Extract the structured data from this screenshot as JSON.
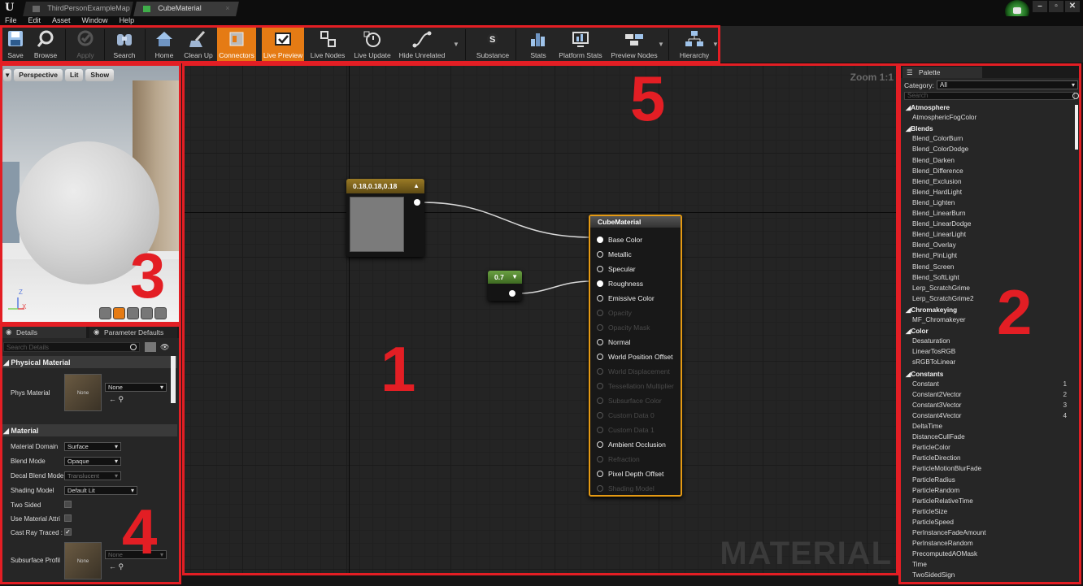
{
  "titlebar": {
    "logo": "U",
    "tabs": [
      {
        "label": "ThirdPersonExampleMap"
      },
      {
        "label": "CubeMaterial"
      }
    ]
  },
  "menubar": [
    "File",
    "Edit",
    "Asset",
    "Window",
    "Help"
  ],
  "toolbar": {
    "items": [
      {
        "label": "Save",
        "icon": "save-icon"
      },
      {
        "label": "Browse",
        "icon": "browse-icon"
      },
      {
        "label": "Apply",
        "icon": "apply-icon",
        "disabled": true
      },
      {
        "label": "Search",
        "icon": "search-icon"
      },
      {
        "label": "Home",
        "icon": "home-icon"
      },
      {
        "label": "Clean Up",
        "icon": "cleanup-icon"
      },
      {
        "label": "Connectors",
        "icon": "connectors-icon",
        "active": true
      },
      {
        "label": "Live Preview",
        "icon": "live-preview-icon",
        "active": true
      },
      {
        "label": "Live Nodes",
        "icon": "live-nodes-icon"
      },
      {
        "label": "Live Update",
        "icon": "live-update-icon"
      },
      {
        "label": "Hide Unrelated",
        "icon": "hide-unrelated-icon"
      },
      {
        "label": "Substance",
        "icon": "substance-icon"
      },
      {
        "label": "Stats",
        "icon": "stats-icon"
      },
      {
        "label": "Platform Stats",
        "icon": "platform-stats-icon"
      },
      {
        "label": "Preview Nodes",
        "icon": "preview-nodes-icon"
      },
      {
        "label": "Hierarchy",
        "icon": "hierarchy-icon"
      }
    ]
  },
  "viewport": {
    "perspective": "Perspective",
    "lit": "Lit",
    "show": "Show",
    "axis_z": "Z",
    "axis_x": "X"
  },
  "details": {
    "tab1": "Details",
    "tab2": "Parameter Defaults",
    "search_placeholder": "Search Details",
    "physical_material_header": "Physical Material",
    "phys_material_label": "Phys Material",
    "phys_material_value": "None",
    "thumb_none": "None",
    "material_header": "Material",
    "rows": [
      {
        "label": "Material Domain",
        "value": "Surface"
      },
      {
        "label": "Blend Mode",
        "value": "Opaque"
      },
      {
        "label": "Decal Blend Mode",
        "value": "Translucent"
      },
      {
        "label": "Shading Model",
        "value": "Default Lit"
      },
      {
        "label": "Two Sided"
      },
      {
        "label": "Use Material Attri"
      },
      {
        "label": "Cast Ray Traced :"
      },
      {
        "label": "Subsurface Profil",
        "value": "None"
      }
    ]
  },
  "graph": {
    "zoom": "Zoom 1:1",
    "watermark": "MATERIAL",
    "color_node": "0.18,0.18,0.18",
    "scalar_node": "0.7",
    "main_node": {
      "title": "CubeMaterial",
      "pins": [
        {
          "label": "Base Color",
          "state": "connected"
        },
        {
          "label": "Metallic",
          "state": "open"
        },
        {
          "label": "Specular",
          "state": "open"
        },
        {
          "label": "Roughness",
          "state": "connected"
        },
        {
          "label": "Emissive Color",
          "state": "open"
        },
        {
          "label": "Opacity",
          "state": "disabled"
        },
        {
          "label": "Opacity Mask",
          "state": "disabled"
        },
        {
          "label": "Normal",
          "state": "open"
        },
        {
          "label": "World Position Offset",
          "state": "open"
        },
        {
          "label": "World Displacement",
          "state": "disabled"
        },
        {
          "label": "Tessellation Multiplier",
          "state": "disabled"
        },
        {
          "label": "Subsurface Color",
          "state": "disabled"
        },
        {
          "label": "Custom Data 0",
          "state": "disabled"
        },
        {
          "label": "Custom Data 1",
          "state": "disabled"
        },
        {
          "label": "Ambient Occlusion",
          "state": "open"
        },
        {
          "label": "Refraction",
          "state": "disabled"
        },
        {
          "label": "Pixel Depth Offset",
          "state": "open"
        },
        {
          "label": "Shading Model",
          "state": "disabled"
        }
      ]
    }
  },
  "palette": {
    "tab": "Palette",
    "category_label": "Category:",
    "category_value": "All",
    "search_placeholder": "Search",
    "items": [
      {
        "text": "Atmosphere",
        "header": true
      },
      {
        "text": "AtmosphericFogColor"
      },
      {
        "text": "Blends",
        "header": true
      },
      {
        "text": "Blend_ColorBurn"
      },
      {
        "text": "Blend_ColorDodge"
      },
      {
        "text": "Blend_Darken"
      },
      {
        "text": "Blend_Difference"
      },
      {
        "text": "Blend_Exclusion"
      },
      {
        "text": "Blend_HardLight"
      },
      {
        "text": "Blend_Lighten"
      },
      {
        "text": "Blend_LinearBurn"
      },
      {
        "text": "Blend_LinearDodge"
      },
      {
        "text": "Blend_LinearLight"
      },
      {
        "text": "Blend_Overlay"
      },
      {
        "text": "Blend_PinLight"
      },
      {
        "text": "Blend_Screen"
      },
      {
        "text": "Blend_SoftLight"
      },
      {
        "text": "Lerp_ScratchGrime"
      },
      {
        "text": "Lerp_ScratchGrime2"
      },
      {
        "text": "Chromakeying",
        "header": true
      },
      {
        "text": "MF_Chromakeyer"
      },
      {
        "text": "Color",
        "header": true
      },
      {
        "text": "Desaturation"
      },
      {
        "text": "LinearTosRGB"
      },
      {
        "text": "sRGBToLinear"
      },
      {
        "text": "Constants",
        "header": true
      },
      {
        "text": "Constant",
        "key": "1"
      },
      {
        "text": "Constant2Vector",
        "key": "2"
      },
      {
        "text": "Constant3Vector",
        "key": "3"
      },
      {
        "text": "Constant4Vector",
        "key": "4"
      },
      {
        "text": "DeltaTime"
      },
      {
        "text": "DistanceCullFade"
      },
      {
        "text": "ParticleColor"
      },
      {
        "text": "ParticleDirection"
      },
      {
        "text": "ParticleMotionBlurFade"
      },
      {
        "text": "ParticleRadius"
      },
      {
        "text": "ParticleRandom"
      },
      {
        "text": "ParticleRelativeTime"
      },
      {
        "text": "ParticleSize"
      },
      {
        "text": "ParticleSpeed"
      },
      {
        "text": "PerInstanceFadeAmount"
      },
      {
        "text": "PerInstanceRandom"
      },
      {
        "text": "PrecomputedAOMask"
      },
      {
        "text": "Time"
      },
      {
        "text": "TwoSidedSign"
      }
    ]
  },
  "annotations": {
    "n1": "1",
    "n2": "2",
    "n3": "3",
    "n4": "4",
    "n5": "5",
    "color": "#e31e24"
  }
}
